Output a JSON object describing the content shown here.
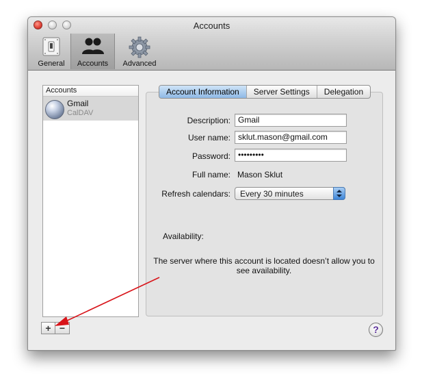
{
  "window": {
    "title": "Accounts"
  },
  "toolbar": {
    "items": [
      {
        "label": "General",
        "icon": "general-switch-icon"
      },
      {
        "label": "Accounts",
        "icon": "accounts-people-icon",
        "selected": true
      },
      {
        "label": "Advanced",
        "icon": "advanced-gear-icon"
      }
    ]
  },
  "sidebar": {
    "header": "Accounts",
    "accounts": [
      {
        "name": "Gmail",
        "type": "CalDAV"
      }
    ],
    "add_label": "+",
    "remove_label": "−"
  },
  "tabs": [
    "Account Information",
    "Server Settings",
    "Delegation"
  ],
  "form": {
    "description_label": "Description:",
    "description_value": "Gmail",
    "username_label": "User name:",
    "username_value": "sklut.mason@gmail.com",
    "password_label": "Password:",
    "password_value": "•••••••••",
    "fullname_label": "Full name:",
    "fullname_value": "Mason Sklut",
    "refresh_label": "Refresh calendars:",
    "refresh_value": "Every 30 minutes"
  },
  "availability": {
    "label": "Availability:",
    "message": "The server where this account is located doesn’t allow you to see availability."
  },
  "help_label": "?",
  "colors": {
    "selected_tab": "#8fb9e6",
    "annotation_arrow": "#d8141a"
  }
}
